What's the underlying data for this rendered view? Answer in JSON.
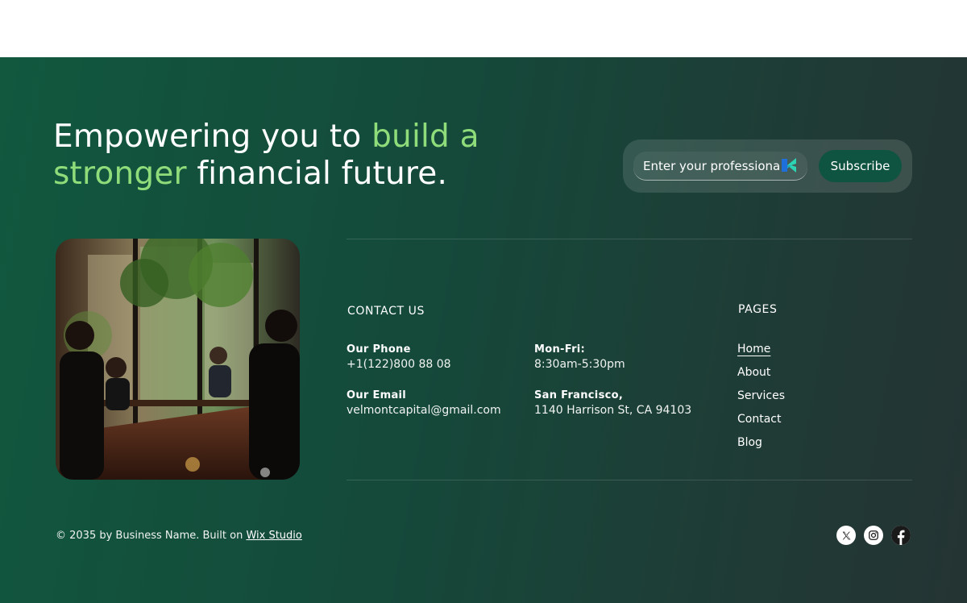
{
  "hero": {
    "headline_part1": "Empowering you to ",
    "headline_accent1": "build a",
    "headline_accent2": "stronger",
    "headline_part2": " financial future."
  },
  "subscribe": {
    "email_placeholder": "Enter your professional e...",
    "button_label": "Subscribe"
  },
  "contact": {
    "title": "CONTACT US",
    "phone_label": "Our Phone",
    "phone_value": "+1(122)800 88 08",
    "hours_label": "Mon-Fri:",
    "hours_value": "8:30am-5:30pm",
    "email_label": "Our Email",
    "email_value": "velmontcapital@gmail.com",
    "address_label": "San Francisco,",
    "address_value": "1140 Harrison St, CA 94103"
  },
  "pages": {
    "title": "PAGES",
    "items": [
      "Home",
      "About",
      "Services",
      "Contact",
      "Blog"
    ]
  },
  "footer": {
    "copyright_text": "© 2035 by Business Name. Built on ",
    "copyright_link": "Wix Studio"
  },
  "socials": [
    "x-icon",
    "instagram-icon",
    "facebook-icon"
  ],
  "colors": {
    "accent_green": "#8fdc7a",
    "button_green": "#0f5440",
    "footer_bg_start": "#11583f",
    "footer_bg_end": "#243433"
  }
}
